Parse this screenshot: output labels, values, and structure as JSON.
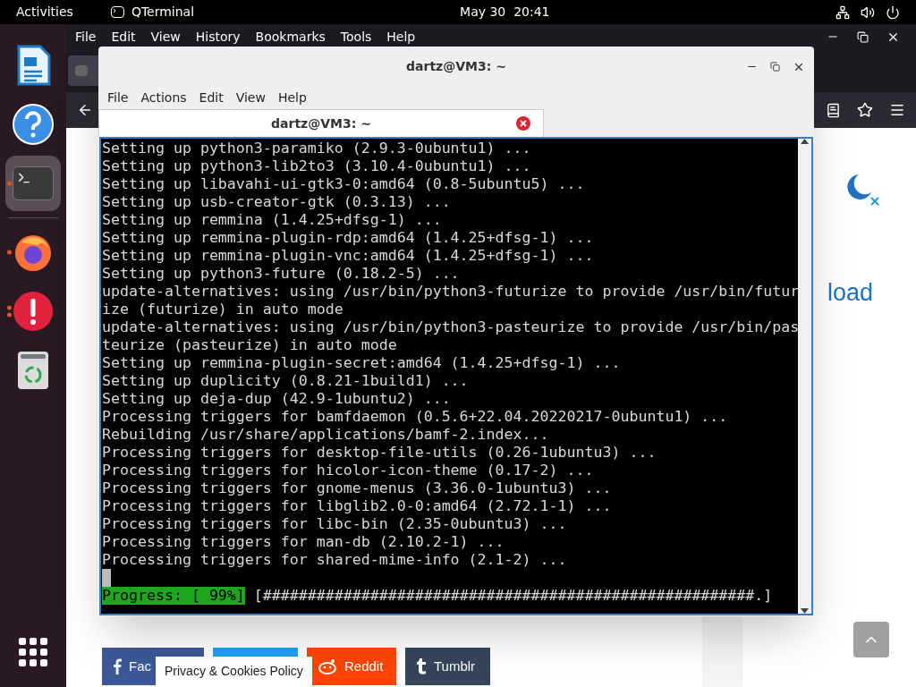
{
  "top_bar": {
    "activities": "Activities",
    "app_name": "QTerminal",
    "clock": "May 30  20:41"
  },
  "dock": {
    "favorites": [
      {
        "kind": "writer",
        "running": false,
        "multi_window": false,
        "selected": false
      },
      {
        "kind": "help",
        "running": false,
        "multi_window": false,
        "selected": false
      },
      {
        "kind": "terminal",
        "running": true,
        "multi_window": false,
        "selected": true
      }
    ],
    "others": [
      {
        "kind": "firefox",
        "running": true,
        "multi_window": false,
        "selected": false
      },
      {
        "kind": "warning",
        "running": true,
        "multi_window": true,
        "selected": false
      },
      {
        "kind": "trash",
        "running": false,
        "multi_window": false,
        "selected": false
      }
    ]
  },
  "browser": {
    "menu": [
      "File",
      "Edit",
      "View",
      "History",
      "Bookmarks",
      "Tools",
      "Help"
    ],
    "page": {
      "heading_fragment": "load",
      "share_buttons": [
        {
          "kind": "facebook",
          "label": "Fac"
        },
        {
          "kind": "twitter"
        },
        {
          "kind": "reddit",
          "label": "Reddit"
        },
        {
          "kind": "tumblr",
          "label": "Tumblr"
        }
      ],
      "cookie_notice": "Privacy & Cookies Policy"
    }
  },
  "terminal": {
    "window_title": "dartz@VM3: ~",
    "menu": [
      "File",
      "Actions",
      "Edit",
      "View",
      "Help"
    ],
    "tabs": [
      {
        "title": "dartz@VM3: ~",
        "selected": true
      }
    ],
    "lines": [
      "Setting up python3-paramiko (2.9.3-0ubuntu1) ...",
      "Setting up python3-lib2to3 (3.10.4-0ubuntu1) ...",
      "Setting up libavahi-ui-gtk3-0:amd64 (0.8-5ubuntu5) ...",
      "Setting up usb-creator-gtk (0.3.13) ...",
      "Setting up remmina (1.4.25+dfsg-1) ...",
      "Setting up remmina-plugin-rdp:amd64 (1.4.25+dfsg-1) ...",
      "Setting up remmina-plugin-vnc:amd64 (1.4.25+dfsg-1) ...",
      "Setting up python3-future (0.18.2-5) ...",
      "update-alternatives: using /usr/bin/python3-futurize to provide /usr/bin/futur",
      "ize (futurize) in auto mode",
      "update-alternatives: using /usr/bin/python3-pasteurize to provide /usr/bin/pas",
      "teurize (pasteurize) in auto mode",
      "Setting up remmina-plugin-secret:amd64 (1.4.25+dfsg-1) ...",
      "Setting up duplicity (0.8.21-1build1) ...",
      "Setting up deja-dup (42.9-1ubuntu2) ...",
      "Processing triggers for bamfdaemon (0.5.6+22.04.20220217-0ubuntu1) ...",
      "Rebuilding /usr/share/applications/bamf-2.index...",
      "Processing triggers for desktop-file-utils (0.26-1ubuntu3) ...",
      "Processing triggers for hicolor-icon-theme (0.17-2) ...",
      "Processing triggers for gnome-menus (3.36.0-1ubuntu3) ...",
      "Processing triggers for libglib2.0-0:amd64 (2.72.1-1) ...",
      "Processing triggers for libc-bin (2.35-0ubuntu3) ...",
      "Processing triggers for man-db (2.10.2-1) ...",
      "Processing triggers for shared-mime-info (2.1-2) ..."
    ],
    "progress_label": "Progress: [ 99%]",
    "progress_bar": "[#######################################################.]"
  }
}
